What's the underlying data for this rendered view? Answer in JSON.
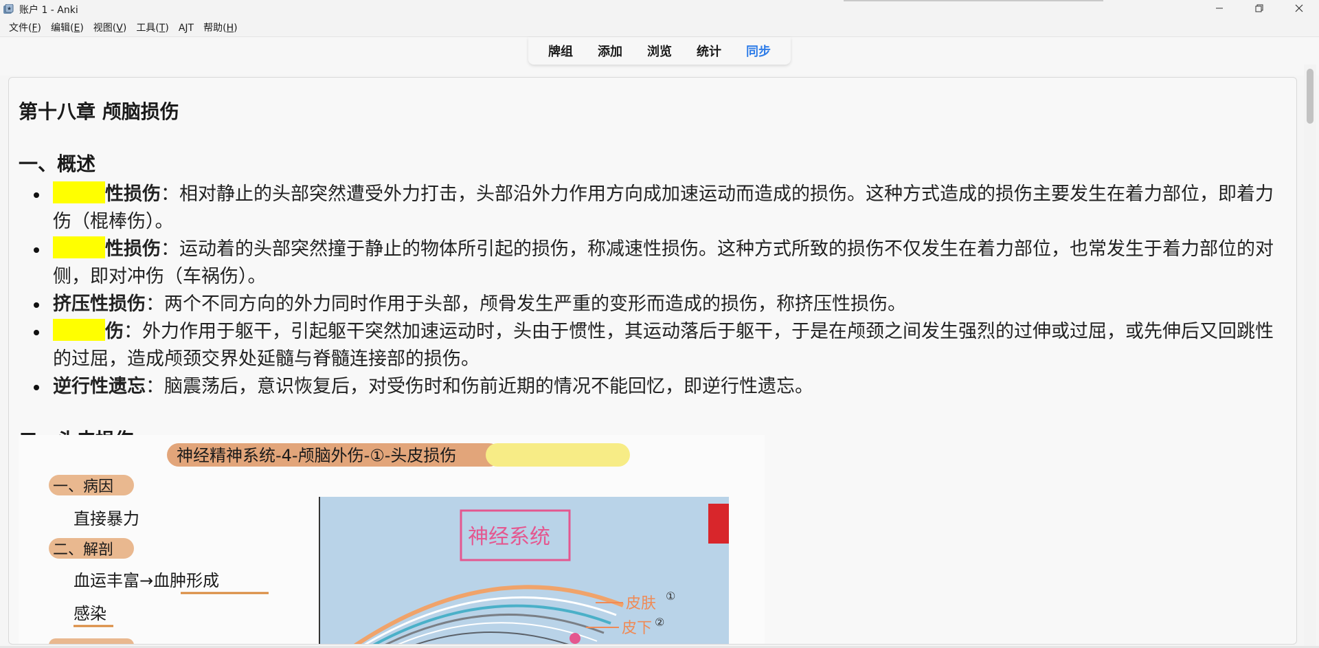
{
  "window": {
    "title": "账户 1 - Anki",
    "minimize_glyph": "—",
    "restore_glyph": "❐",
    "close_glyph": "✕"
  },
  "menubar": {
    "items": [
      {
        "label": "文件(",
        "key": "F",
        "end": ")"
      },
      {
        "label": "编辑(",
        "key": "E",
        "end": ")"
      },
      {
        "label": "视图(",
        "key": "V",
        "end": ")"
      },
      {
        "label": "工具(",
        "key": "T",
        "end": ")"
      },
      {
        "label": "A",
        "key": "J",
        "end": "T"
      },
      {
        "label": "帮助(",
        "key": "H",
        "end": ")"
      }
    ]
  },
  "topnav": {
    "items": [
      "牌组",
      "添加",
      "浏览",
      "统计",
      "同步"
    ],
    "active_index": 4,
    "active_color": "#2f7de8"
  },
  "card": {
    "chapter_title": "第十八章 颅脑损伤",
    "section1": {
      "title": "一、概述",
      "points": [
        {
          "cloze": true,
          "term": "性损伤",
          "text": "：相对静止的头部突然遭受外力打击，头部沿外力作用方向成加速运动而造成的损伤。这种方式造成的损伤主要发生在着力部位，即着力伤（棍棒伤）。"
        },
        {
          "cloze": true,
          "term": "性损伤",
          "text": "：运动着的头部突然撞于静止的物体所引起的损伤，称减速性损伤。这种方式所致的损伤不仅发生在着力部位，也常发生于着力部位的对侧，即对冲伤（车祸伤）。"
        },
        {
          "cloze": false,
          "term": "挤压性损伤",
          "text": "：两个不同方向的外力同时作用于头部，颅骨发生严重的变形而造成的损伤，称挤压性损伤。"
        },
        {
          "cloze": true,
          "term": "伤",
          "text": "：外力作用于躯干，引起躯干突然加速运动时，头由于惯性，其运动落后于躯干，于是在颅颈之间发生强烈的过伸或过屈，或先伸后又回跳性的过屈，造成颅颈交界处延髓与脊髓连接部的损伤。"
        },
        {
          "cloze": false,
          "term": "逆行性遗忘",
          "text": "：脑震荡后，意识恢复后，对受伤时和伤前近期的情况不能回忆，即逆行性遗忘。"
        }
      ]
    },
    "section2": {
      "title": "二、头皮损伤"
    }
  },
  "note_image": {
    "banner": "神经精神系统-4-颅脑外伤-①-头皮损伤",
    "heading1": "一、病因",
    "line1": "直接暴力",
    "heading2": "二、解剖",
    "line2": "血运丰富→血肿形成",
    "line3": "感染",
    "box_label": "神经系统",
    "label_scalp": "皮肤",
    "label_subcut": "皮下",
    "marker1": "①",
    "marker2": "②",
    "cloze_color": "#ffff00"
  }
}
